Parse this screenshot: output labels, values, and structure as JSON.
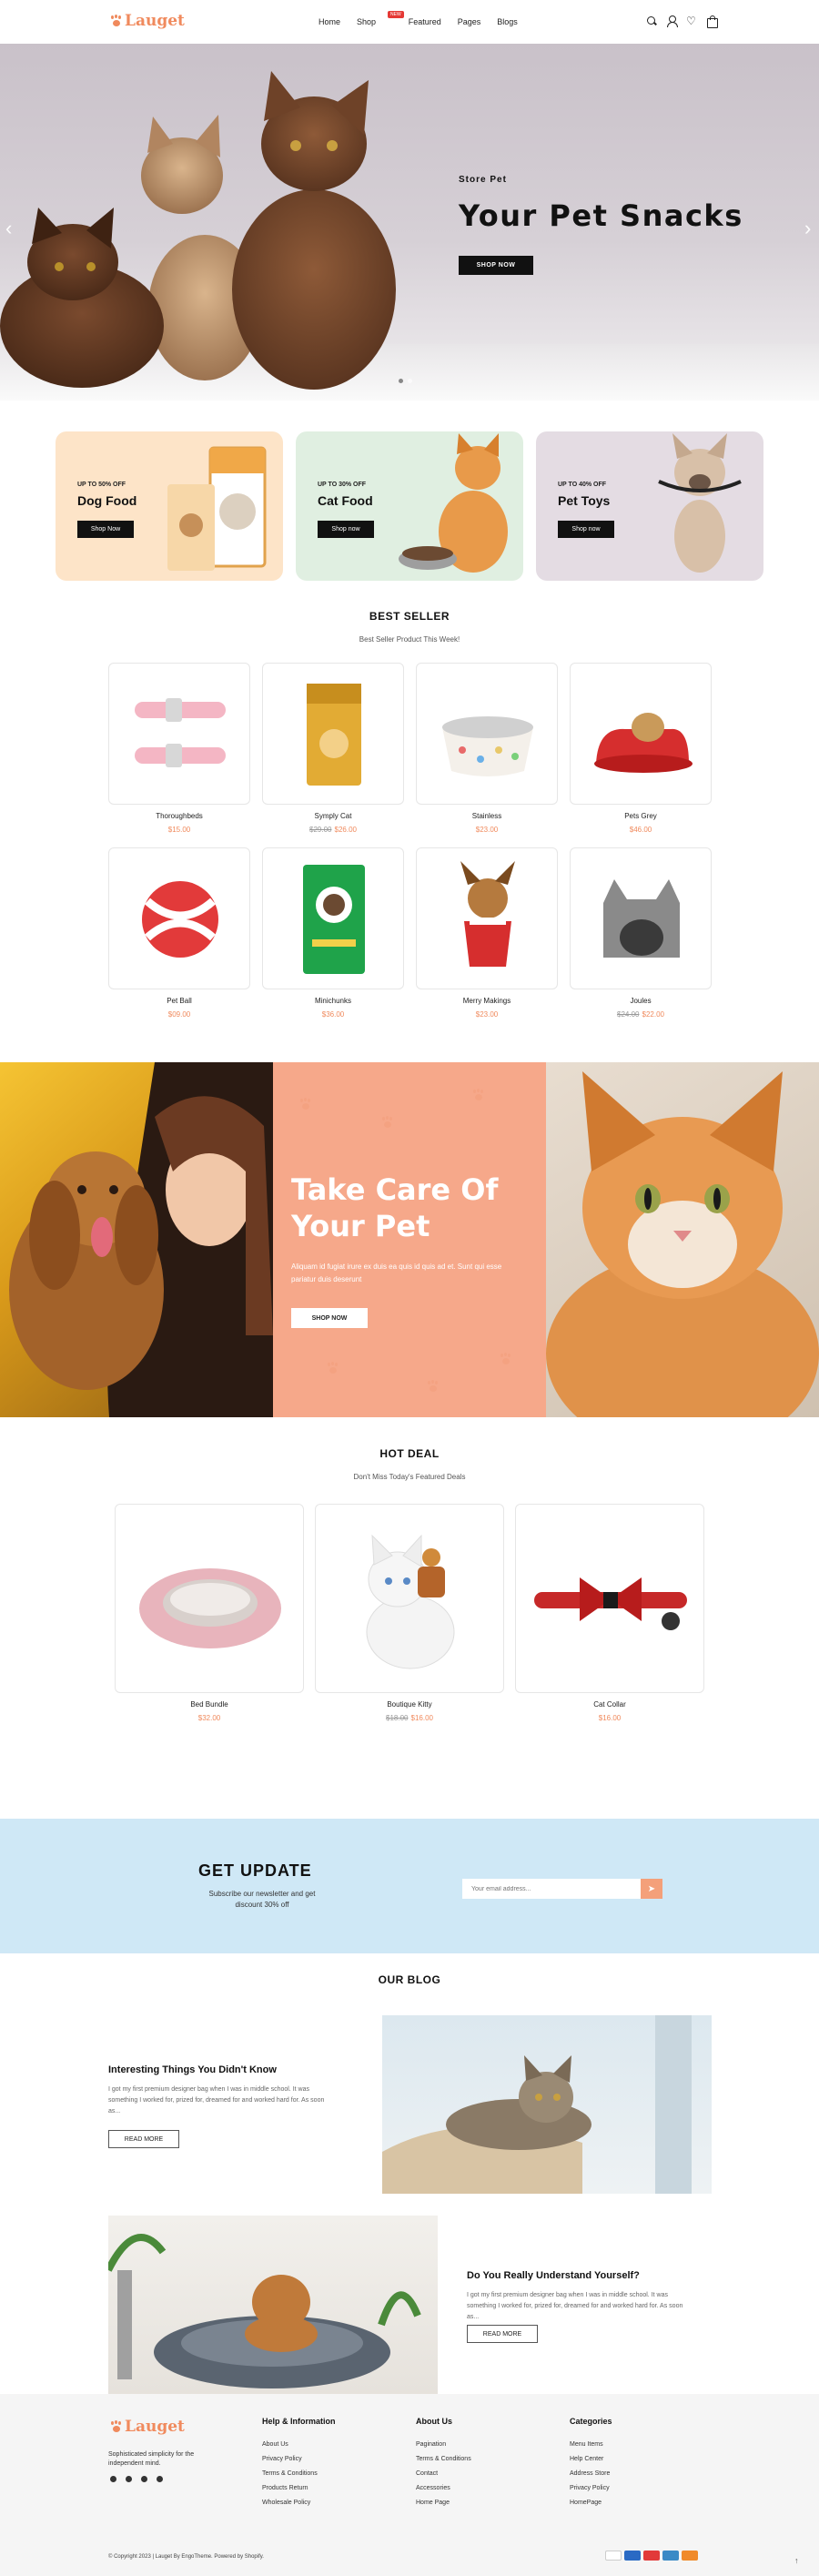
{
  "brand": {
    "name": "Lauget",
    "accent": "#f08a5d"
  },
  "nav": {
    "items": [
      "Home",
      "Shop",
      "Featured",
      "Pages",
      "Blogs"
    ],
    "badge": "NEW"
  },
  "header_icons": [
    "search-icon",
    "user-icon",
    "heart-icon",
    "bag-icon"
  ],
  "hero": {
    "subtitle": "Store Pet",
    "title": "Your Pet Snacks",
    "button": "SHOP NOW",
    "prev": "‹",
    "next": "›"
  },
  "promos": [
    {
      "tag": "UP TO 50% OFF",
      "title": "Dog Food",
      "button": "Shop Now",
      "bg": "#fde4c8"
    },
    {
      "tag": "UP TO 30% OFF",
      "title": "Cat Food",
      "button": "Shop now",
      "bg": "#e0efe1"
    },
    {
      "tag": "UP TO 40% OFF",
      "title": "Pet Toys",
      "button": "Shop now",
      "bg": "#e4dce3"
    }
  ],
  "best_seller": {
    "title": "BEST SELLER",
    "subtitle": "Best Seller Product This Week!",
    "products": [
      {
        "name": "Thoroughbeds",
        "old_price": "",
        "price": "$15.00"
      },
      {
        "name": "Symply Cat",
        "old_price": "$29.00",
        "price": "$26.00"
      },
      {
        "name": "Stainless",
        "old_price": "",
        "price": "$23.00"
      },
      {
        "name": "Pets Grey",
        "old_price": "",
        "price": "$46.00"
      },
      {
        "name": "Pet Ball",
        "old_price": "",
        "price": "$09.00"
      },
      {
        "name": "Minichunks",
        "old_price": "",
        "price": "$36.00"
      },
      {
        "name": "Merry Makings",
        "old_price": "",
        "price": "$23.00"
      },
      {
        "name": "Joules",
        "old_price": "$24.00",
        "price": "$22.00"
      }
    ]
  },
  "care_banner": {
    "title_line1": "Take Care Of",
    "title_line2": "Your Pet",
    "text": "Aliquam id fugiat irure ex duis ea quis id quis ad et. Sunt qui esse pariatur duis deserunt",
    "button": "SHOP NOW"
  },
  "hot_deal": {
    "title": "HOT DEAL",
    "subtitle": "Don't Miss Today's Featured Deals",
    "products": [
      {
        "name": "Bed Bundle",
        "old_price": "",
        "price": "$32.00"
      },
      {
        "name": "Boutique Kitty",
        "old_price": "$18.00",
        "price": "$16.00"
      },
      {
        "name": "Cat Collar",
        "old_price": "",
        "price": "$16.00"
      }
    ]
  },
  "newsletter": {
    "title": "GET UPDATE",
    "text": "Subscribe our newsletter and get discount 30% off",
    "placeholder": "Your email address...",
    "send_icon": "send-icon"
  },
  "blog": {
    "title": "OUR BLOG",
    "posts": [
      {
        "title": "Interesting Things You Didn't Know",
        "text": "I got my first premium designer bag when I was in middle school. It was something I worked for, prized for, dreamed for and worked hard for. As soon as...",
        "button": "READ MORE"
      },
      {
        "title": "Do You Really Understand Yourself?",
        "text": "I got my first premium designer bag when I was in middle school. It was something I worked for, prized for, dreamed for and worked hard for. As soon as...",
        "button": "READ MORE"
      }
    ]
  },
  "footer": {
    "logo": "Lauget",
    "description": "Sophisticated simplicity for the independent mind.",
    "columns": [
      {
        "title": "Help & Information",
        "links": [
          "About Us",
          "Privacy Policy",
          "Terms & Conditions",
          "Products Return",
          "Wholesale Policy"
        ]
      },
      {
        "title": "About Us",
        "links": [
          "Pagination",
          "Terms & Conditions",
          "Contact",
          "Accessories",
          "Home Page"
        ]
      },
      {
        "title": "Categories",
        "links": [
          "Menu Items",
          "Help Center",
          "Address Store",
          "Privacy Policy",
          "HomePage"
        ]
      }
    ],
    "copyright": "© Copyright 2023 | Lauget By EngoTheme. Powered by Shopify.",
    "payments": [
      "visa",
      "paypal",
      "mastercard",
      "amex",
      "discover"
    ]
  }
}
